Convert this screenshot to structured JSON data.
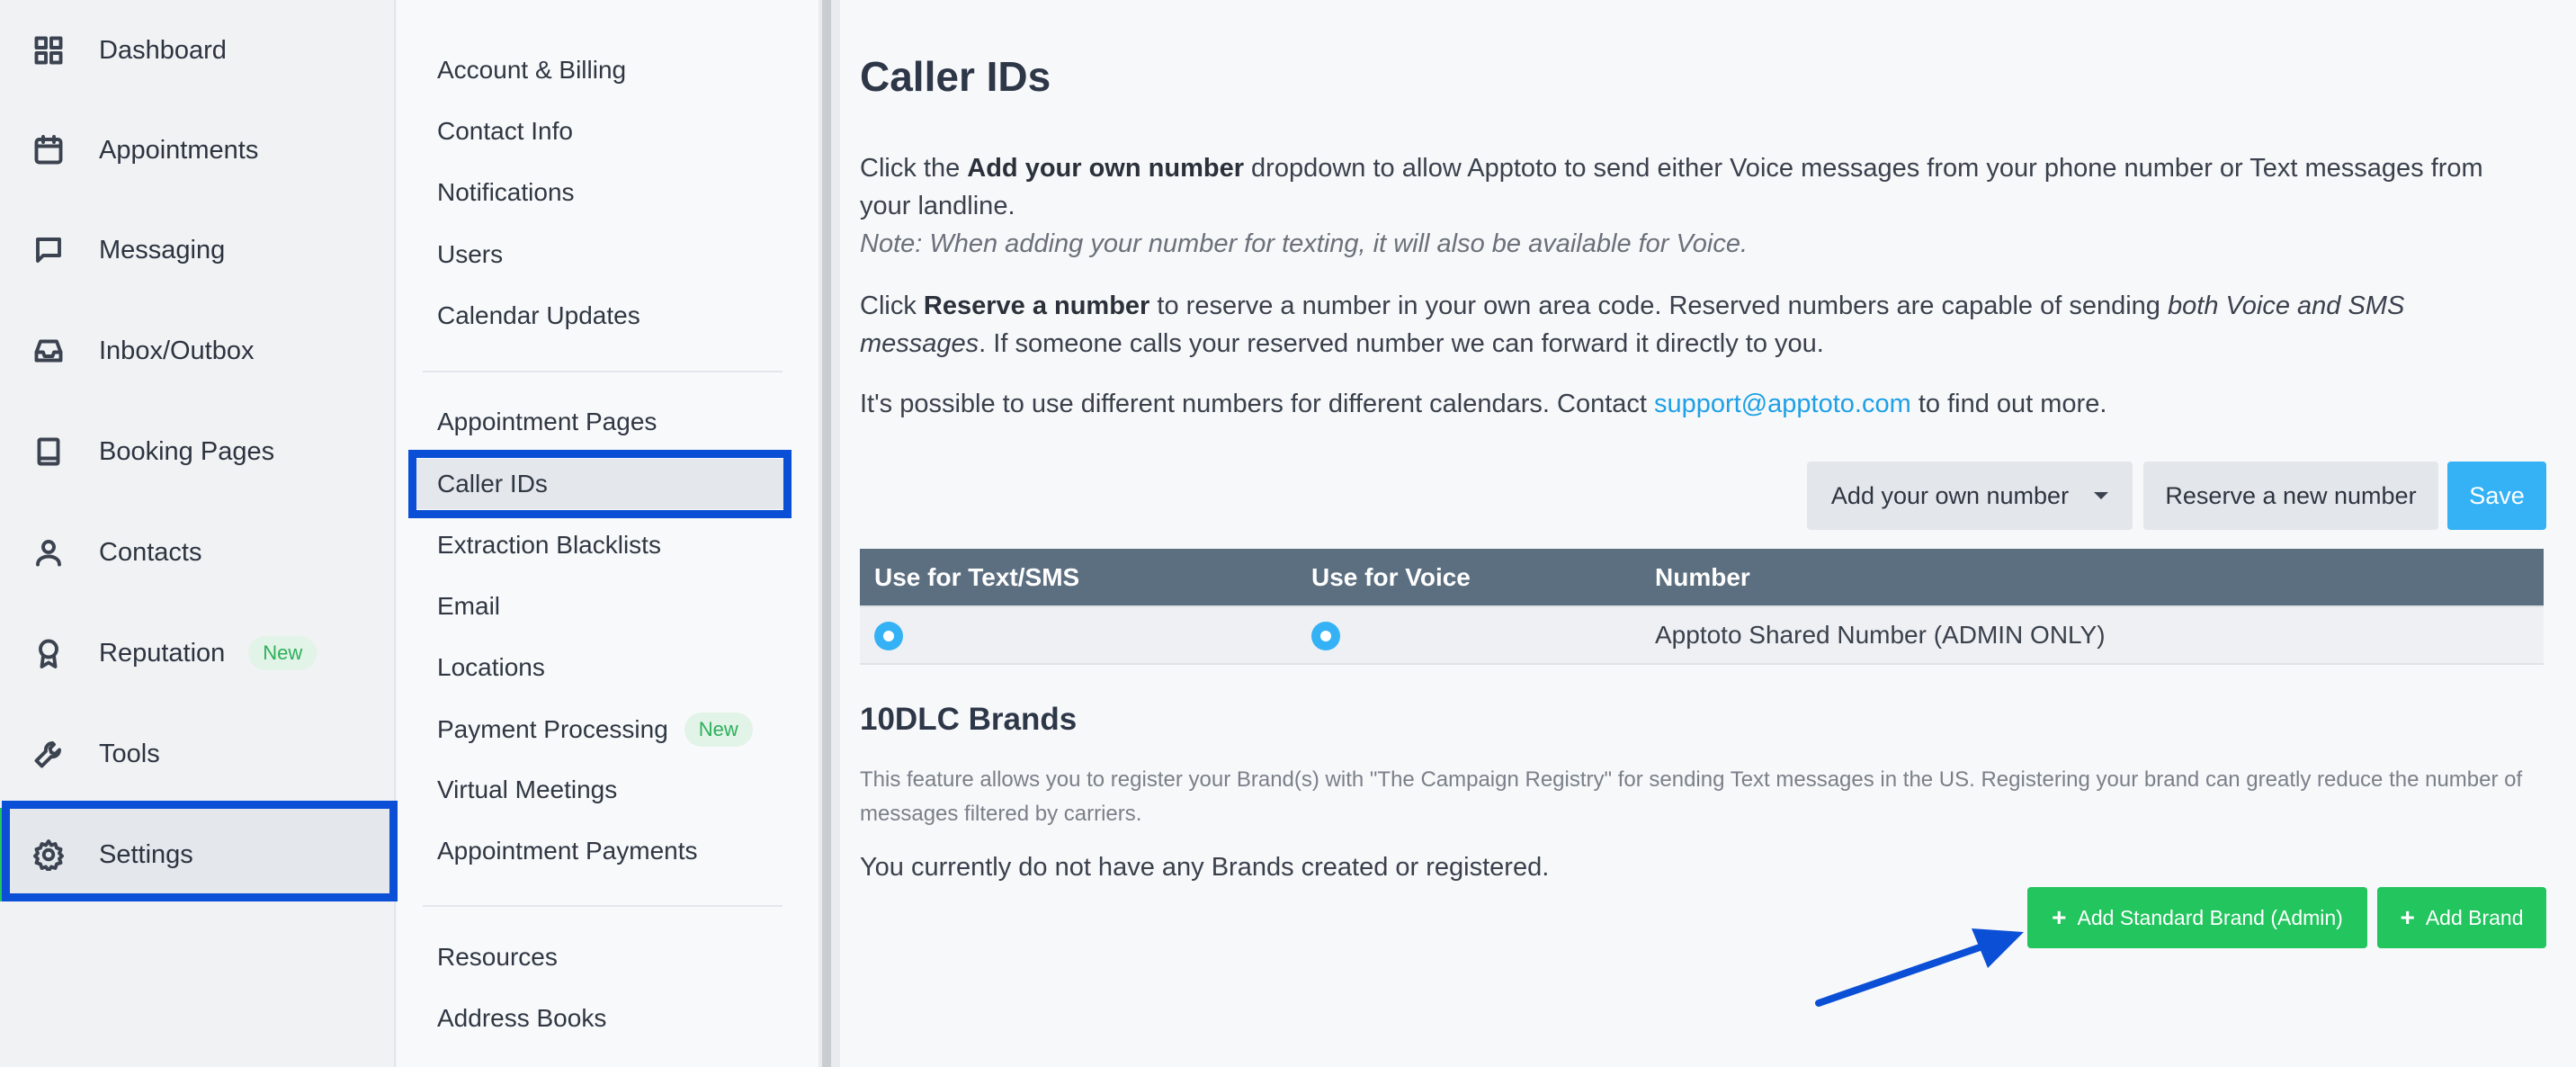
{
  "nav": {
    "items": [
      {
        "label": "Dashboard",
        "icon": "grid-icon"
      },
      {
        "label": "Appointments",
        "icon": "calendar-icon"
      },
      {
        "label": "Messaging",
        "icon": "chat-icon"
      },
      {
        "label": "Inbox/Outbox",
        "icon": "inbox-icon"
      },
      {
        "label": "Booking Pages",
        "icon": "book-icon"
      },
      {
        "label": "Contacts",
        "icon": "user-icon"
      },
      {
        "label": "Reputation",
        "icon": "award-icon",
        "badge": "New"
      },
      {
        "label": "Tools",
        "icon": "wrench-icon"
      },
      {
        "label": "Settings",
        "icon": "gear-icon",
        "active": true
      }
    ]
  },
  "settings_menu": {
    "group1": [
      "Account & Billing",
      "Contact Info",
      "Notifications",
      "Users",
      "Calendar Updates"
    ],
    "group2": [
      "Appointment Pages",
      "Caller IDs",
      "Extraction Blacklists",
      "Email",
      "Locations",
      "Payment Processing",
      "Virtual Meetings",
      "Appointment Payments"
    ],
    "payment_badge": "New",
    "group3": [
      "Resources",
      "Address Books"
    ],
    "active": "Caller IDs"
  },
  "main": {
    "title": "Caller IDs",
    "p1_pre": "Click the ",
    "p1_bold": "Add your own number",
    "p1_post": " dropdown to allow Apptoto to send either Voice messages from your phone number or Text messages from your landline.",
    "p1_note": "Note: When adding your number for texting, it will also be available for Voice.",
    "p2_pre": "Click ",
    "p2_bold": "Reserve a number",
    "p2_mid": " to reserve a number in your own area code. Reserved numbers are capable of sending ",
    "p2_italic": "both Voice and SMS messages",
    "p2_post": ". If someone calls your reserved number we can forward it directly to you.",
    "p3_pre": "It's possible to use different numbers for different calendars. Contact ",
    "p3_link": "support@apptoto.com",
    "p3_post": " to find out more.",
    "buttons": {
      "add_own": "Add your own number",
      "reserve": "Reserve a new number",
      "save": "Save"
    },
    "table": {
      "headers": [
        "Use for Text/SMS",
        "Use for Voice",
        "Number"
      ],
      "rows": [
        {
          "text_sms_selected": true,
          "voice_selected": true,
          "number": "Apptoto Shared Number (ADMIN ONLY)"
        }
      ]
    },
    "brands": {
      "title": "10DLC Brands",
      "description": "This feature allows you to register your Brand(s) with \"The Campaign Registry\" for sending Text messages in the US. Registering your brand can greatly reduce the number of messages filtered by carriers.",
      "empty": "You currently do not have any Brands created or registered.",
      "add_standard": "Add Standard Brand (Admin)",
      "add_brand": "Add Brand"
    }
  },
  "colors": {
    "accent_blue": "#34b2f5",
    "green": "#22c55e",
    "highlight": "#0a4fd6",
    "table_header": "#5c6f80"
  }
}
